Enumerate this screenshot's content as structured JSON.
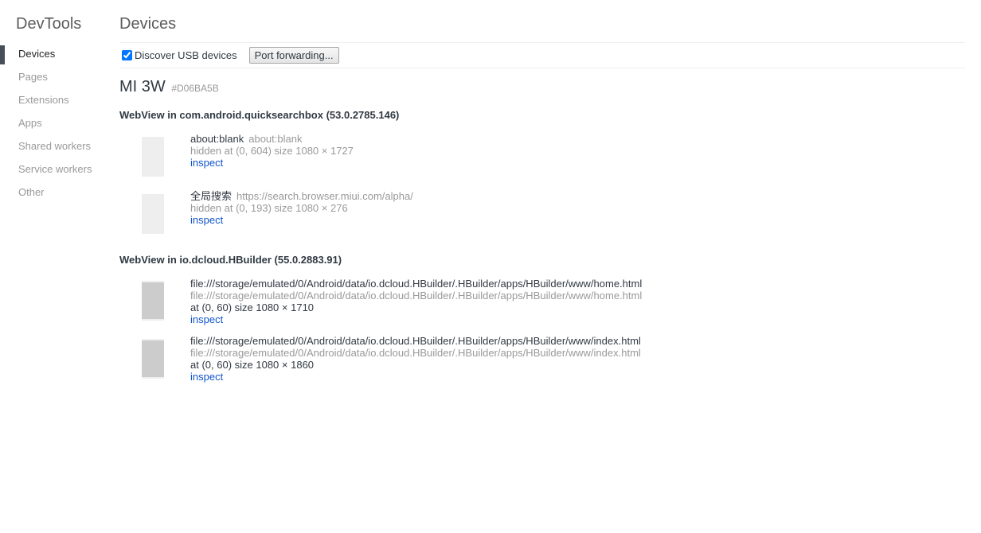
{
  "sidebar": {
    "title": "DevTools",
    "items": [
      {
        "label": "Devices"
      },
      {
        "label": "Pages"
      },
      {
        "label": "Extensions"
      },
      {
        "label": "Apps"
      },
      {
        "label": "Shared workers"
      },
      {
        "label": "Service workers"
      },
      {
        "label": "Other"
      }
    ],
    "active_index": 0
  },
  "header": {
    "title": "Devices"
  },
  "toolbar": {
    "discover_label": "Discover USB devices",
    "discover_checked": true,
    "port_forwarding_label": "Port forwarding..."
  },
  "device": {
    "name": "MI 3W",
    "serial": "#D06BA5B"
  },
  "browsers": [
    {
      "name": "WebView in com.android.quicksearchbox (53.0.2785.146)",
      "pages": [
        {
          "title": "about:blank",
          "url": "about:blank",
          "meta": "hidden  at (0, 604)  size 1080 × 1727",
          "action": "inspect"
        },
        {
          "title": "全局搜索",
          "url": "https://search.browser.miui.com/alpha/",
          "meta": "hidden  at (0, 193)  size 1080 × 276",
          "action": "inspect"
        }
      ]
    },
    {
      "name": "WebView in io.dcloud.HBuilder (55.0.2883.91)",
      "pages": [
        {
          "title": "file:///storage/emulated/0/Android/data/io.dcloud.HBuilder/.HBuilder/apps/HBuilder/www/home.html",
          "url": "file:///storage/emulated/0/Android/data/io.dcloud.HBuilder/.HBuilder/apps/HBuilder/www/home.html",
          "meta": "at (0, 60)  size 1080 × 1710",
          "action": "inspect"
        },
        {
          "title": "file:///storage/emulated/0/Android/data/io.dcloud.HBuilder/.HBuilder/apps/HBuilder/www/index.html",
          "url": "file:///storage/emulated/0/Android/data/io.dcloud.HBuilder/.HBuilder/apps/HBuilder/www/index.html",
          "meta": "at (0, 60)  size 1080 × 1860",
          "action": "inspect"
        }
      ]
    }
  ]
}
